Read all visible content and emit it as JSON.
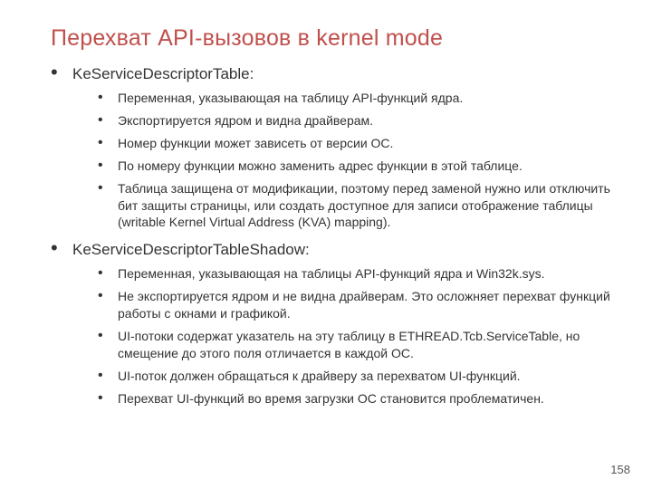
{
  "title": "Перехват API-вызовов в kernel mode",
  "sections": [
    {
      "heading": "KeServiceDescriptorTable:",
      "items": [
        "Переменная, указывающая на таблицу API-функций ядра.",
        "Экспортируется ядром и видна драйверам.",
        "Номер функции может зависеть от версии ОС.",
        "По номеру функции можно заменить адрес функции в этой таблице.",
        "Таблица защищена от модификации, поэтому перед заменой нужно или отключить бит защиты страницы, или создать доступное для записи отображение таблицы (writable Kernel Virtual Address (KVA) mapping)."
      ]
    },
    {
      "heading": "KeServiceDescriptorTableShadow:",
      "items": [
        "Переменная, указывающая на таблицы API-функций ядра и Win32k.sys.",
        "Не экспортируется ядром и не видна драйверам. Это осложняет перехват функций работы с окнами и графикой.",
        "UI-потоки содержат указатель на эту таблицу в ETHREAD.Tcb.ServiceTable, но смещение до этого поля отличается в каждой ОС.",
        "UI-поток должен обращаться к драйверу за перехватом UI-функций.",
        "Перехват UI-функций во время загрузки ОС становится проблематичен."
      ]
    }
  ],
  "page_number": "158"
}
